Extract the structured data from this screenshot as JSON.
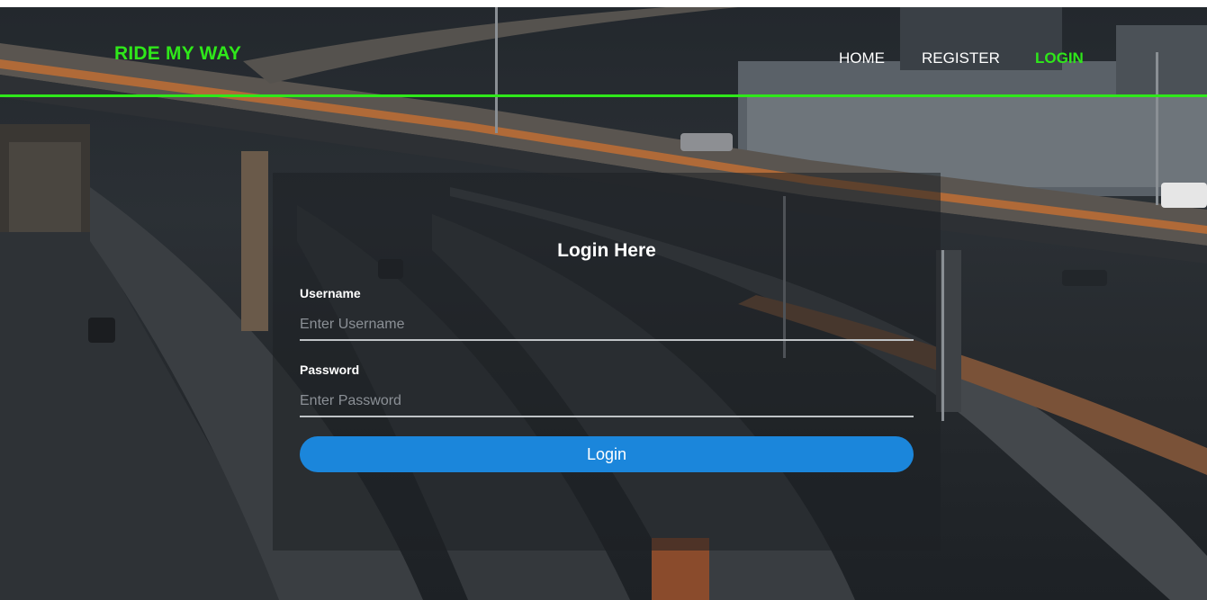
{
  "nav": {
    "brand": "RIDE MY WAY",
    "links": [
      {
        "label": "HOME"
      },
      {
        "label": "REGISTER"
      },
      {
        "label": "LOGIN"
      }
    ],
    "accent_color": "#2fe81a"
  },
  "login": {
    "title": "Login Here",
    "username_label": "Username",
    "username_placeholder": "Enter Username",
    "password_label": "Password",
    "password_placeholder": "Enter Password",
    "submit_label": "Login",
    "button_color": "#1b86db"
  }
}
